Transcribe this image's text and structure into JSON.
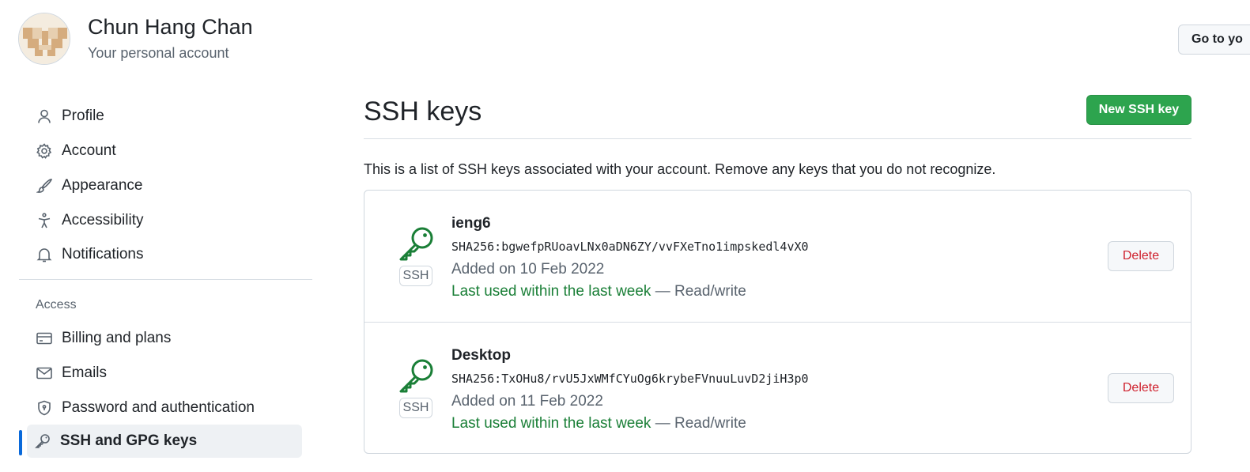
{
  "account": {
    "name": "Chun Hang Chan",
    "subtitle": "Your personal account",
    "goto_button": "Go to yo"
  },
  "sidebar": {
    "items": [
      {
        "label": "Profile",
        "icon": "person-icon"
      },
      {
        "label": "Account",
        "icon": "gear-icon"
      },
      {
        "label": "Appearance",
        "icon": "paintbrush-icon"
      },
      {
        "label": "Accessibility",
        "icon": "accessibility-icon"
      },
      {
        "label": "Notifications",
        "icon": "bell-icon"
      }
    ],
    "access_heading": "Access",
    "access_items": [
      {
        "label": "Billing and plans",
        "icon": "credit-card-icon"
      },
      {
        "label": "Emails",
        "icon": "mail-icon"
      },
      {
        "label": "Password and authentication",
        "icon": "shield-lock-icon"
      },
      {
        "label": "SSH and GPG keys",
        "icon": "key-icon",
        "selected": true
      }
    ]
  },
  "main": {
    "title": "SSH keys",
    "new_key_button": "New SSH key",
    "intro": "This is a list of SSH keys associated with your account. Remove any keys that you do not recognize.",
    "keys": [
      {
        "title": "ieng6",
        "badge": "SSH",
        "fingerprint": "SHA256:bgwefpRUoavLNx0aDN6ZY/vvFXeTno1impskedl4vX0",
        "added": "Added on 10 Feb 2022",
        "last_used": "Last used within the last week",
        "access": "— Read/write",
        "delete_label": "Delete"
      },
      {
        "title": "Desktop",
        "badge": "SSH",
        "fingerprint": "SHA256:TxOHu8/rvU5JxWMfCYuOg6krybeFVnuuLuvD2jiH3p0",
        "added": "Added on 11 Feb 2022",
        "last_used": "Last used within the last week",
        "access": "— Read/write",
        "delete_label": "Delete"
      }
    ]
  },
  "colors": {
    "accent_blue": "#0969da",
    "primary_green": "#2da44e",
    "key_green": "#1a7f37",
    "danger_red": "#cf222e"
  }
}
